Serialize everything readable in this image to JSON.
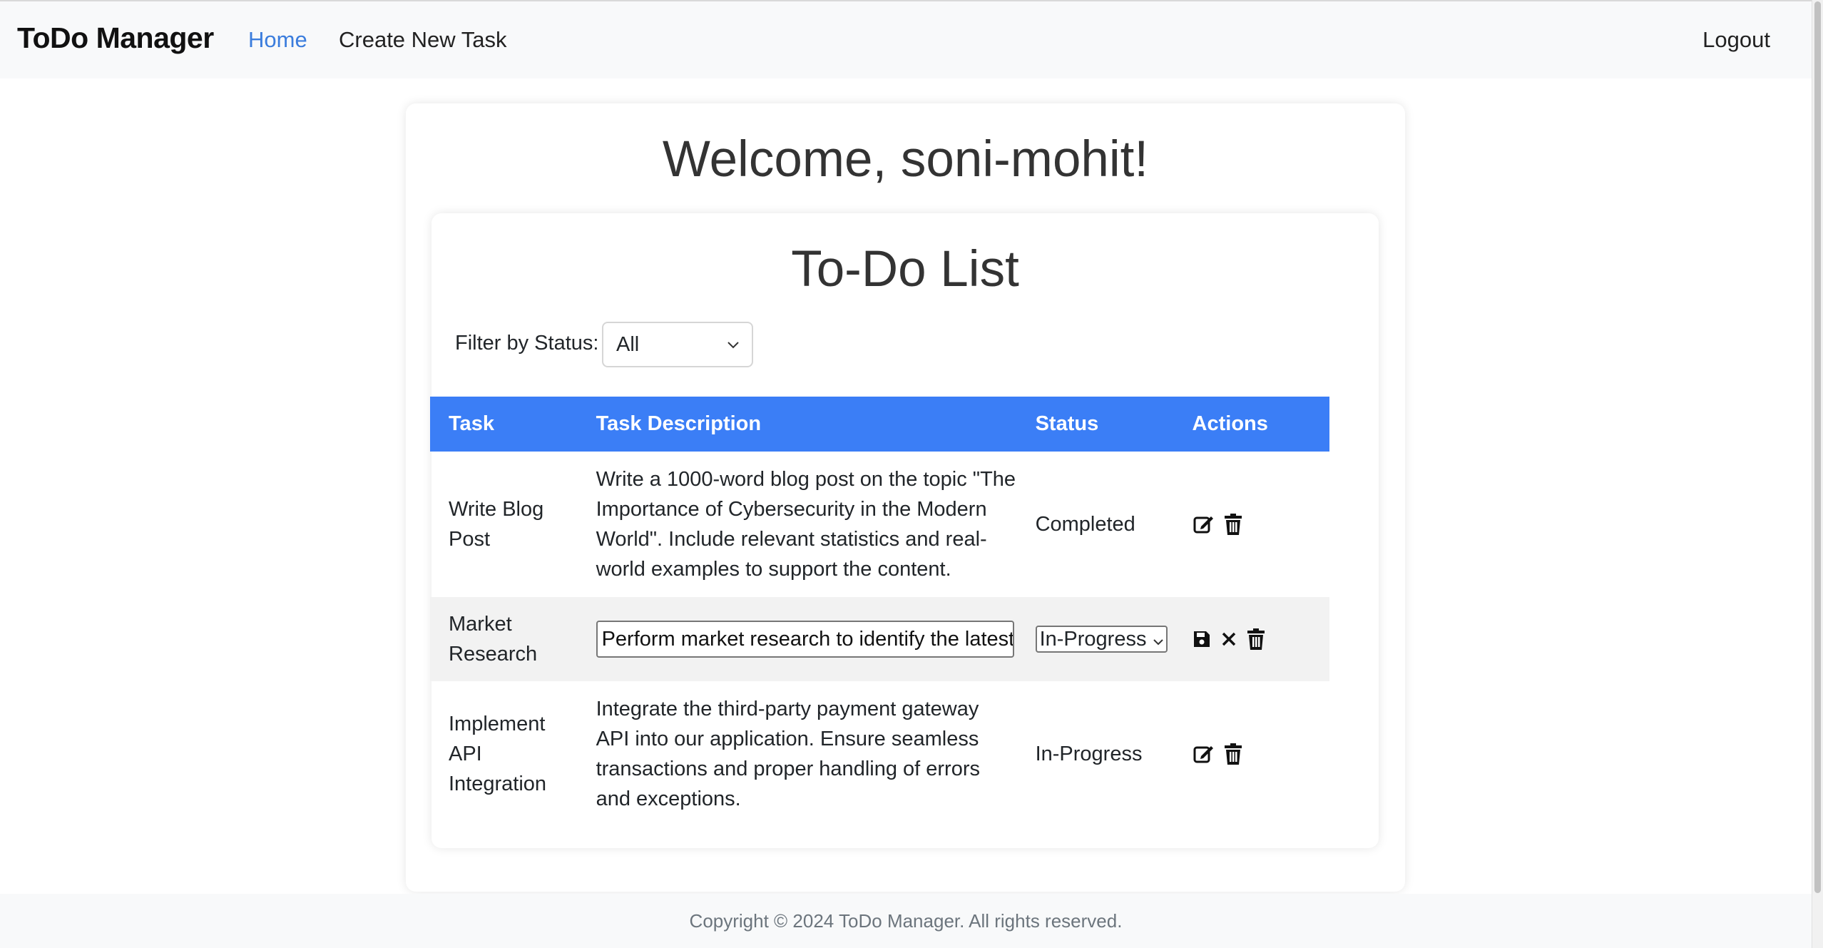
{
  "nav": {
    "brand": "ToDo Manager",
    "home": "Home",
    "create": "Create New Task",
    "logout": "Logout"
  },
  "main": {
    "welcome": "Welcome, soni-mohit!",
    "list_title": "To-Do List",
    "filter": {
      "label": "Filter by Status:",
      "selected": "All"
    }
  },
  "table": {
    "headers": [
      "Task",
      "Task Description",
      "Status",
      "Actions"
    ],
    "rows": [
      {
        "task": "Write Blog Post",
        "description": "Write a 1000-word blog post on the topic \"The Importance of Cybersecurity in the Modern World\". Include relevant statistics and real-world examples to support the content.",
        "status": "Completed",
        "actions": [
          "edit-icon",
          "trash-icon"
        ]
      },
      {
        "task": "Market Research",
        "description": "Perform market research to identify the latest",
        "status": "In-Progress",
        "actions": [
          "save-icon",
          "close-icon",
          "trash-icon"
        ]
      },
      {
        "task": "Implement API Integration",
        "description": "Integrate the third-party payment gateway API into our application. Ensure seamless transactions and proper handling of errors and exceptions.",
        "status": "In-Progress",
        "actions": [
          "edit-icon",
          "trash-icon"
        ]
      }
    ]
  },
  "footer": {
    "text": "Copyright © 2024 ToDo Manager. All rights reserved."
  },
  "colors": {
    "primary": "#3b7ef6",
    "link": "#3b7ddd",
    "navbar_bg": "#f8f9fa"
  }
}
